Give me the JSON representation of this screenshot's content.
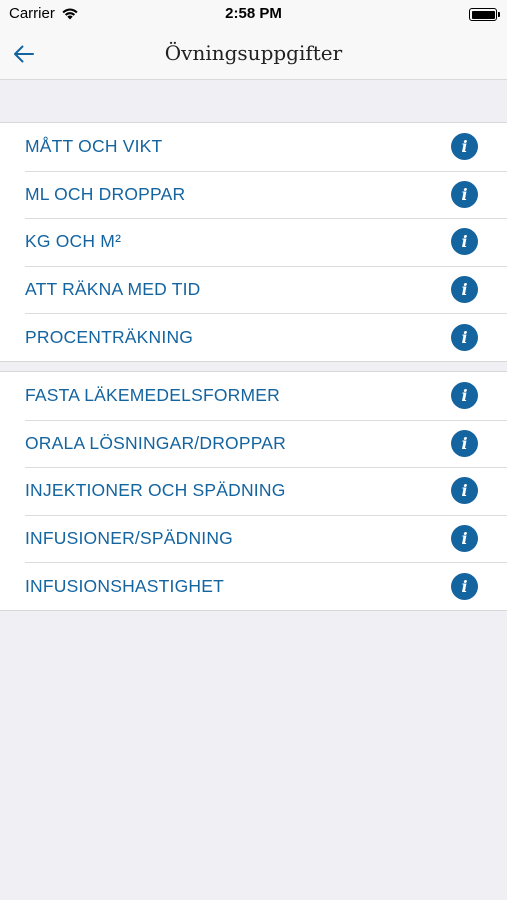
{
  "status_bar": {
    "carrier": "Carrier",
    "time": "2:58 PM"
  },
  "nav": {
    "title": "Övningsuppgifter",
    "back_icon": "arrow-left-icon"
  },
  "sections": [
    {
      "items": [
        {
          "label": "MÅTT OCH VIKT"
        },
        {
          "label": "ML OCH DROPPAR"
        },
        {
          "label": "KG OCH M²"
        },
        {
          "label": "ATT RÄKNA MED TID"
        },
        {
          "label": "PROCENTRÄKNING"
        }
      ]
    },
    {
      "items": [
        {
          "label": "FASTA LÄKEMEDELSFORMER"
        },
        {
          "label": "ORALA LÖSNINGAR/DROPPAR"
        },
        {
          "label": "INJEKTIONER OCH SPÄDNING"
        },
        {
          "label": "INFUSIONER/SPÄDNING"
        },
        {
          "label": "INFUSIONSHASTIGHET"
        }
      ]
    }
  ],
  "info_icon_glyph": "i",
  "colors": {
    "accent": "#1464a0",
    "background": "#efeff4",
    "nav_background": "#f8f8f8"
  }
}
